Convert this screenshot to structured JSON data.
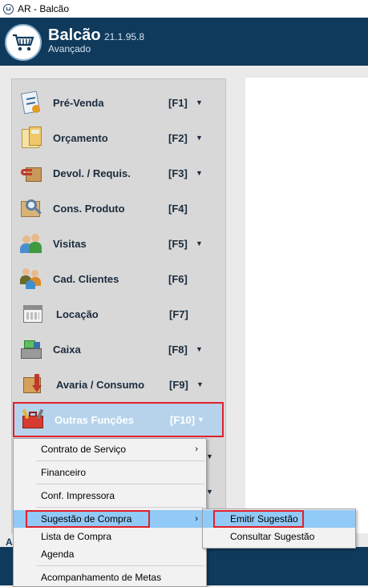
{
  "window": {
    "title": "AR - Balcão"
  },
  "header": {
    "app_name": "Balcão",
    "version": "21.1.95.8",
    "edition": "Avançado"
  },
  "menu": [
    {
      "label": "Pré-Venda",
      "key": "[F1]",
      "arrow": "▼",
      "icon": "clipboard-icon"
    },
    {
      "label": "Orçamento",
      "key": "[F2]",
      "arrow": "▼",
      "icon": "calculator-icon"
    },
    {
      "label": "Devol. / Requis.",
      "key": "[F3]",
      "arrow": "▼",
      "icon": "return-box-icon"
    },
    {
      "label": "Cons. Produto",
      "key": "[F4]",
      "arrow": "",
      "icon": "magnifier-icon"
    },
    {
      "label": "Visitas",
      "key": "[F5]",
      "arrow": "▼",
      "icon": "people-icon"
    },
    {
      "label": "Cad. Clientes",
      "key": "[F6]",
      "arrow": "",
      "icon": "clients-icon"
    },
    {
      "label": "Locação",
      "key": "[F7]",
      "arrow": "",
      "icon": "calendar-icon"
    },
    {
      "label": "Caixa",
      "key": "[F8]",
      "arrow": "▼",
      "icon": "cash-register-icon"
    },
    {
      "label": "Avaria / Consumo",
      "key": "[F9]",
      "arrow": "▼",
      "icon": "damaged-box-icon"
    },
    {
      "label": "Outras Funções",
      "key": "[F10]",
      "arrow": "▼",
      "icon": "toolbox-icon"
    }
  ],
  "context_menu": {
    "items": [
      {
        "label": "Contrato de Serviço",
        "submenu": "›"
      },
      {
        "label": "Financeiro",
        "submenu": ""
      },
      {
        "label": "Conf. Impressora",
        "submenu": ""
      },
      {
        "label": "Sugestão de Compra",
        "submenu": "›"
      },
      {
        "label": "Lista de Compra",
        "submenu": ""
      },
      {
        "label": "Agenda",
        "submenu": ""
      },
      {
        "label": "Acompanhamento de Metas",
        "submenu": ""
      }
    ]
  },
  "submenu": {
    "items": [
      {
        "label": "Emitir Sugestão"
      },
      {
        "label": "Consultar Sugestão"
      }
    ]
  },
  "footer": {
    "text": "A"
  },
  "colors": {
    "header": "#0f3a5c",
    "selection": "#b7d3ec",
    "highlight_border": "#e0202a",
    "hover": "#91c9f7"
  }
}
